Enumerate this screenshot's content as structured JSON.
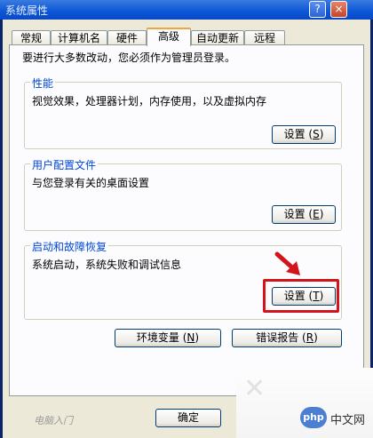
{
  "window": {
    "title": "系统属性",
    "help_label": "?",
    "close_label": "×"
  },
  "tabs": [
    {
      "label": "常规",
      "active": false
    },
    {
      "label": "计算机名",
      "active": false
    },
    {
      "label": "硬件",
      "active": false
    },
    {
      "label": "高级",
      "active": true
    },
    {
      "label": "自动更新",
      "active": false
    },
    {
      "label": "远程",
      "active": false
    }
  ],
  "intro": "要进行大多数改动，您必须作为管理员登录。",
  "groups": {
    "performance": {
      "title": "性能",
      "desc": "视觉效果，处理器计划，内存使用，以及虚拟内存",
      "button": {
        "label": "设置",
        "key": "S"
      }
    },
    "profile": {
      "title": "用户配置文件",
      "desc": "与您登录有关的桌面设置",
      "button": {
        "label": "设置",
        "key": "E"
      }
    },
    "startup": {
      "title": "启动和故障恢复",
      "desc": "系统启动，系统失败和调试信息",
      "button": {
        "label": "设置",
        "key": "T"
      }
    }
  },
  "env_button": {
    "label": "环境变量",
    "key": "N"
  },
  "error_button": {
    "label": "错误报告",
    "key": "R"
  },
  "ok_button": {
    "label": "确定"
  },
  "watermark": {
    "left": "电脑入门",
    "right_logo": "php",
    "right_text": "中文网"
  },
  "colors": {
    "highlight": "#d4141b",
    "title_bar": "#0b56d6",
    "group_title": "#0046d5"
  }
}
